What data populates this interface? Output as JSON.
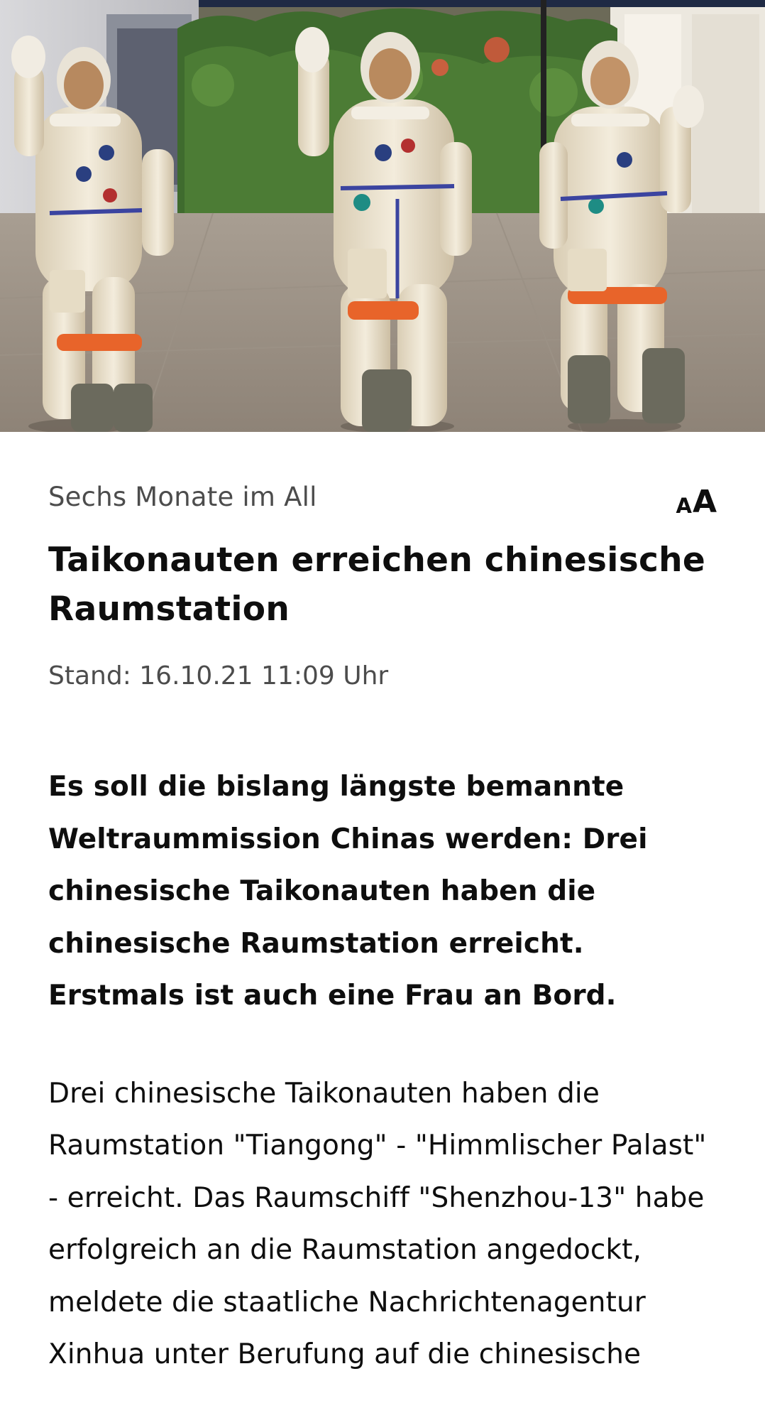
{
  "hero_image": {
    "alt": "hero-image"
  },
  "article": {
    "topline": "Sechs Monate im All",
    "font_size_toggle": {
      "small": "A",
      "large": "A"
    },
    "headline": "Taikonauten erreichen chinesische Raumstation",
    "stand": "Stand: 16.10.21 11:09 Uhr",
    "teaser": "Es soll die bislang längste bemannte Weltraummission Chinas werden: Drei chinesische Taikonauten haben die chinesische Raumstation erreicht. Erstmals ist auch eine Frau an Bord.",
    "body": "Drei chinesische Taikonauten haben die Raumstation \"Tiangong\" - \"Himmlischer Palast\" - erreicht. Das Raumschiff \"Shenzhou-13\" habe erfolgreich an die Raumstation angedockt, meldete die staatliche Nachrichtenagentur Xinhua unter Berufung auf die chinesische"
  },
  "colors": {
    "text_primary": "#0e0e0e",
    "text_secondary": "#4c4c4c",
    "background": "#ffffff"
  }
}
